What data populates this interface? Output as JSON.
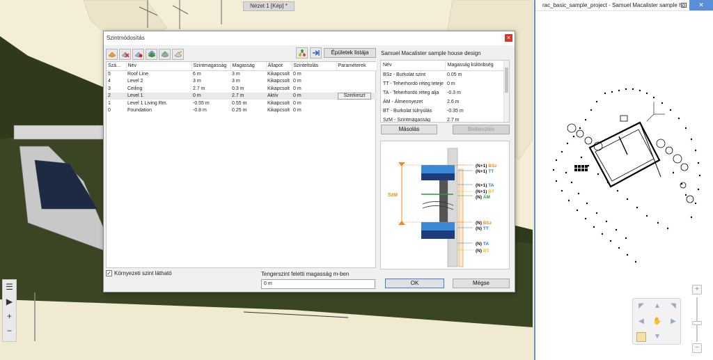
{
  "viewport": {
    "tab_title": "Nézet 1 [Kép] *"
  },
  "floorplan": {
    "title": "rac_basic_sample_project - Samuel Macalister sample ho"
  },
  "dialog": {
    "title": "Szintmódosítás",
    "close_label": "×",
    "buildings_list_label": "Épületek listája",
    "project_name": "Samuel Macalister sample house design",
    "copy_label": "Másolás",
    "paste_label": "Beillesztés",
    "visible_env_label": "Környezeti szint látható",
    "visible_env_checked": true,
    "sea_level_label": "Tengerszint feletti magasság m-ben",
    "sea_level_value": "0 m",
    "ok_label": "OK",
    "cancel_label": "Mégse",
    "levels": {
      "columns": [
        "Szá...",
        "Név",
        "Szintmagasság",
        "Magasság",
        "Állapot",
        "Szinteltolás",
        "Paraméterek"
      ],
      "rows": [
        {
          "num": "5",
          "name": "Roof Line",
          "level_height": "6 m",
          "height": "3 m",
          "state": "Kikapcsolt",
          "offset": "0 m",
          "param": ""
        },
        {
          "num": "4",
          "name": "Level 2",
          "level_height": "3 m",
          "height": "3 m",
          "state": "Kikapcsolt",
          "offset": "0 m",
          "param": ""
        },
        {
          "num": "3",
          "name": "Ceiling",
          "level_height": "2.7 m",
          "height": "0.3 m",
          "state": "Kikapcsolt",
          "offset": "0 m",
          "param": ""
        },
        {
          "num": "2",
          "name": "Level 1",
          "level_height": "0 m",
          "height": "2.7 m",
          "state": "Aktív",
          "offset": "0 m",
          "param": "Szerkeszt"
        },
        {
          "num": "1",
          "name": "Level 1 Living Rm.",
          "level_height": "-0.55 m",
          "height": "0.55 m",
          "state": "Kikapcsolt",
          "offset": "0 m",
          "param": ""
        },
        {
          "num": "0",
          "name": "Foundation",
          "level_height": "-0.8 m",
          "height": "0.25 m",
          "state": "Kikapcsolt",
          "offset": "0 m",
          "param": ""
        }
      ]
    },
    "diffs": {
      "columns": [
        "Név",
        "Magasság különbség"
      ],
      "rows": [
        {
          "name": "BSz - Burkolat szint",
          "value": "0.05 m"
        },
        {
          "name": "TT - Teherhordó réteg teteje",
          "value": "0 m"
        },
        {
          "name": "TA - Teherhordó réteg alja",
          "value": "-0.3 m"
        },
        {
          "name": "ÁM - Álmennyezet",
          "value": "2.6 m"
        },
        {
          "name": "BT - Burkolat túlnyúlás",
          "value": "-0.35 m"
        },
        {
          "name": "SzM - Szintmagasság",
          "value": "2.7 m"
        }
      ]
    },
    "diagram": {
      "szm_label": "SzM",
      "labels": [
        {
          "prefix": "(N+1)",
          "code": "BSz",
          "color": "#f08a1c"
        },
        {
          "prefix": "(N+1)",
          "code": "TT",
          "color": "#1e7fd1"
        },
        {
          "prefix": "(N+1)",
          "code": "TA",
          "color": "#1e7fd1"
        },
        {
          "prefix": "(N+1)",
          "code": "BT",
          "color": "#e8c21a"
        },
        {
          "prefix": "(N)",
          "code": "ÁM",
          "color": "#2a9a3c"
        },
        {
          "prefix": "(N)",
          "code": "BSz",
          "color": "#f08a1c"
        },
        {
          "prefix": "(N)",
          "code": "TT",
          "color": "#1e7fd1"
        },
        {
          "prefix": "(N)",
          "code": "TA",
          "color": "#1e7fd1"
        },
        {
          "prefix": "(N)",
          "code": "BT",
          "color": "#e8c21a"
        }
      ]
    }
  }
}
